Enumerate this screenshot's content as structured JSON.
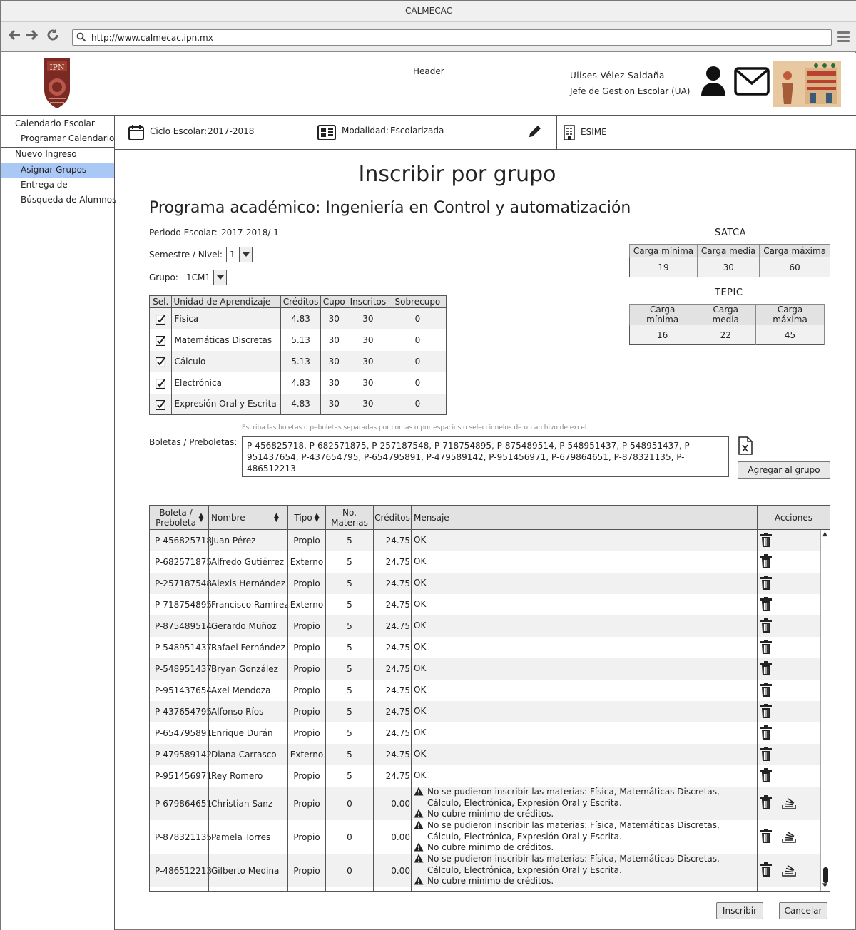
{
  "window": {
    "title": "CALMECAC",
    "url": "http://www.calmecac.ipn.mx"
  },
  "header": {
    "label": "Header",
    "user_name": "Ulises Vélez Saldaña",
    "user_role": "Jefe de Gestion Escolar (UA)",
    "logo_text": "IPN"
  },
  "sidebar": {
    "items": [
      {
        "label": "Calendario Escolar",
        "indent": false,
        "selected": false
      },
      {
        "label": "Programar Calendario",
        "indent": true,
        "selected": false
      },
      {
        "label": "Nuevo Ingreso",
        "indent": false,
        "selected": false
      },
      {
        "label": "Asignar Grupos",
        "indent": true,
        "selected": true
      },
      {
        "label": "Entrega de",
        "indent": true,
        "selected": false
      },
      {
        "label": "Búsqueda de Alumnos",
        "indent": true,
        "selected": false
      }
    ]
  },
  "context": {
    "ciclo_label": "Ciclo Escolar:",
    "ciclo_value": "2017-2018",
    "modalidad_label": "Modalidad:",
    "modalidad_value": "Escolarizada",
    "school": "ESIME"
  },
  "main": {
    "title": "Inscribir por grupo",
    "program": "Programa académico: Ingeniería en Control y automatización",
    "periodo_label": "Periodo Escolar:",
    "periodo_value": "2017-2018/ 1",
    "semestre_label": "Semestre / Nivel:",
    "semestre_value": "1",
    "grupo_label": "Grupo:",
    "grupo_value": "1CM1"
  },
  "courses": {
    "headers": [
      "Sel.",
      "Unidad de Aprendizaje",
      "Créditos",
      "Cupo",
      "Inscritos",
      "Sobrecupo"
    ],
    "rows": [
      {
        "checked": true,
        "name": "Física",
        "creditos": "4.83",
        "cupo": "30",
        "inscritos": "30",
        "sobrecupo": "0"
      },
      {
        "checked": true,
        "name": "Matemáticas Discretas",
        "creditos": "5.13",
        "cupo": "30",
        "inscritos": "30",
        "sobrecupo": "0"
      },
      {
        "checked": true,
        "name": "Cálculo",
        "creditos": "5.13",
        "cupo": "30",
        "inscritos": "30",
        "sobrecupo": "0"
      },
      {
        "checked": true,
        "name": "Electrónica",
        "creditos": "4.83",
        "cupo": "30",
        "inscritos": "30",
        "sobrecupo": "0"
      },
      {
        "checked": true,
        "name": "Expresión Oral y Escrita",
        "creditos": "4.83",
        "cupo": "30",
        "inscritos": "30",
        "sobrecupo": "0"
      }
    ]
  },
  "satca": {
    "title": "SATCA",
    "headers": [
      "Carga mínima",
      "Carga media",
      "Carga máxima"
    ],
    "values": [
      "19",
      "30",
      "60"
    ]
  },
  "tepic": {
    "title": "TEPIC",
    "headers": [
      "Carga mínima",
      "Carga media",
      "Carga máxima"
    ],
    "values": [
      "16",
      "22",
      "45"
    ]
  },
  "boletas": {
    "hint": "Escriba las boletas o peboletas separadas por comas o por espacios o seleccionelos de un archivo de excel.",
    "label": "Boletas / Preboletas:",
    "value": "P-456825718, P-682571875, P-257187548, P-718754895, P-875489514, P-548951437, P-548951437, P-951437654, P-437654795, P-654795891, P-479589142, P-951456971, P-679864651, P-878321135, P-486512213",
    "add_button": "Agregar al grupo"
  },
  "students": {
    "headers": {
      "boleta": "Boleta / Preboleta",
      "nombre": "Nombre",
      "tipo": "Tipo",
      "materias": "No. Materias",
      "creditos": "Créditos",
      "mensaje": "Mensaje",
      "acciones": "Acciones"
    },
    "rows": [
      {
        "boleta": "P-456825718",
        "nombre": "Juan Pérez",
        "tipo": "Propio",
        "materias": "5",
        "creditos": "24.75",
        "mensaje": [
          "OK"
        ],
        "warn": false
      },
      {
        "boleta": "P-682571875",
        "nombre": "Alfredo Gutiérrez",
        "tipo": "Externo",
        "materias": "5",
        "creditos": "24.75",
        "mensaje": [
          "OK"
        ],
        "warn": false
      },
      {
        "boleta": "P-257187548",
        "nombre": "Alexis Hernández",
        "tipo": "Propio",
        "materias": "5",
        "creditos": "24.75",
        "mensaje": [
          "OK"
        ],
        "warn": false
      },
      {
        "boleta": "P-718754895",
        "nombre": "Francisco Ramírez",
        "tipo": "Externo",
        "materias": "5",
        "creditos": "24.75",
        "mensaje": [
          "OK"
        ],
        "warn": false
      },
      {
        "boleta": "P-875489514",
        "nombre": "Gerardo Muñoz",
        "tipo": "Propio",
        "materias": "5",
        "creditos": "24.75",
        "mensaje": [
          "OK"
        ],
        "warn": false
      },
      {
        "boleta": "P-548951437",
        "nombre": "Rafael Fernández",
        "tipo": "Propio",
        "materias": "5",
        "creditos": "24.75",
        "mensaje": [
          "OK"
        ],
        "warn": false
      },
      {
        "boleta": "P-548951437",
        "nombre": "Bryan González",
        "tipo": "Propio",
        "materias": "5",
        "creditos": "24.75",
        "mensaje": [
          "OK"
        ],
        "warn": false
      },
      {
        "boleta": "P-951437654",
        "nombre": "Axel Mendoza",
        "tipo": "Propio",
        "materias": "5",
        "creditos": "24.75",
        "mensaje": [
          "OK"
        ],
        "warn": false
      },
      {
        "boleta": "P-437654795",
        "nombre": "Alfonso Ríos",
        "tipo": "Propio",
        "materias": "5",
        "creditos": "24.75",
        "mensaje": [
          "OK"
        ],
        "warn": false
      },
      {
        "boleta": "P-654795891",
        "nombre": "Enrique Durán",
        "tipo": "Propio",
        "materias": "5",
        "creditos": "24.75",
        "mensaje": [
          "OK"
        ],
        "warn": false
      },
      {
        "boleta": "P-479589142",
        "nombre": "Diana Carrasco",
        "tipo": "Externo",
        "materias": "5",
        "creditos": "24.75",
        "mensaje": [
          "OK"
        ],
        "warn": false
      },
      {
        "boleta": "P-951456971",
        "nombre": "Rey Romero",
        "tipo": "Propio",
        "materias": "5",
        "creditos": "24.75",
        "mensaje": [
          "OK"
        ],
        "warn": false
      },
      {
        "boleta": "P-679864651",
        "nombre": "Christian Sanz",
        "tipo": "Propio",
        "materias": "0",
        "creditos": "0.00",
        "mensaje": [
          "No se pudieron inscribir las materias: Física, Matemáticas Discretas,",
          "Cálculo, Electrónica, Expresión Oral y Escrita.",
          "No cubre minimo de créditos."
        ],
        "warn": true
      },
      {
        "boleta": "P-878321135",
        "nombre": "Pamela Torres",
        "tipo": "Propio",
        "materias": "0",
        "creditos": "0.00",
        "mensaje": [
          "No se pudieron inscribir las materias: Física, Matemáticas Discretas,",
          "Cálculo, Electrónica, Expresión Oral y Escrita.",
          "No cubre minimo de créditos."
        ],
        "warn": true
      },
      {
        "boleta": "P-486512213",
        "nombre": "Gilberto Medina",
        "tipo": "Propio",
        "materias": "0",
        "creditos": "0.00",
        "mensaje": [
          "No se pudieron inscribir las materias: Física, Matemáticas Discretas,",
          "Cálculo, Electrónica, Expresión Oral y Escrita.",
          "No cubre minimo de créditos."
        ],
        "warn": true
      }
    ]
  },
  "footer": {
    "inscribir": "Inscribir",
    "cancelar": "Cancelar"
  }
}
